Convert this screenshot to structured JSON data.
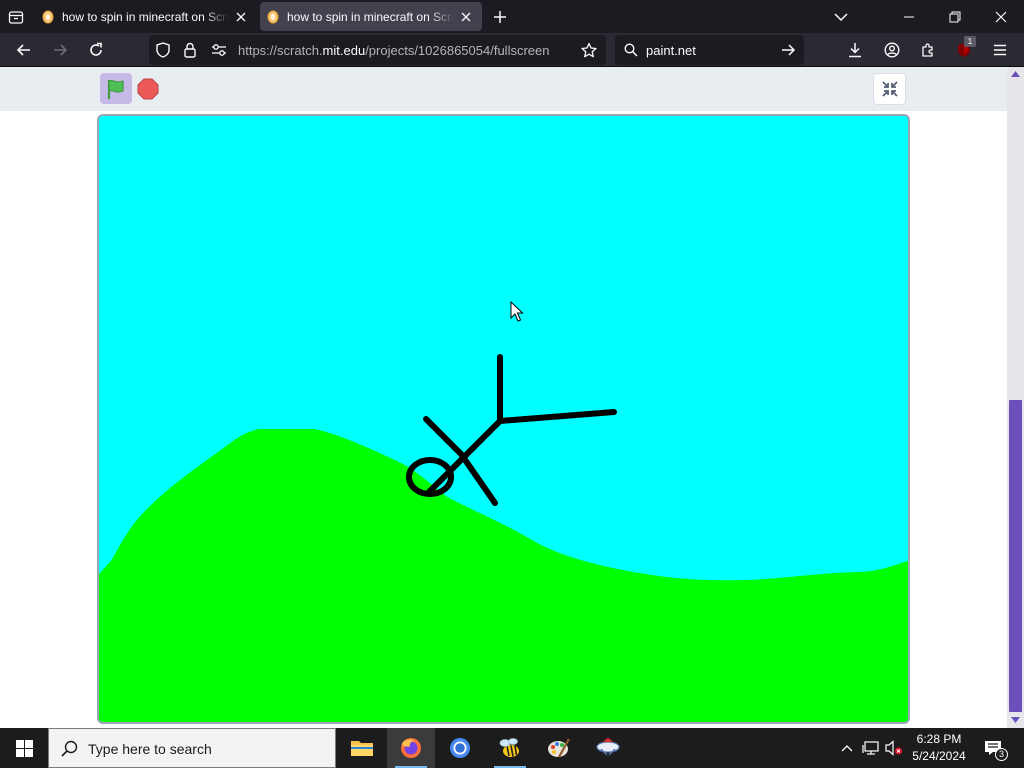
{
  "browser": {
    "tabs": [
      {
        "title": "how to spin in minecraft on Scratch",
        "active": false
      },
      {
        "title": "how to spin in minecraft on Scratch",
        "active": true
      }
    ],
    "url_prefix": "https://scratch.",
    "url_domain": "mit.edu",
    "url_path": "/projects/1026865054/fullscreen",
    "search_text": "paint.net",
    "extension_badge": "1"
  },
  "scratch": {
    "sky_color": "#00ffff",
    "ground_color": "#00ff00",
    "figure_color": "#000000"
  },
  "taskbar": {
    "search_placeholder": "Type here to search",
    "time": "6:28 PM",
    "date": "5/24/2024",
    "notification_count": "3"
  }
}
